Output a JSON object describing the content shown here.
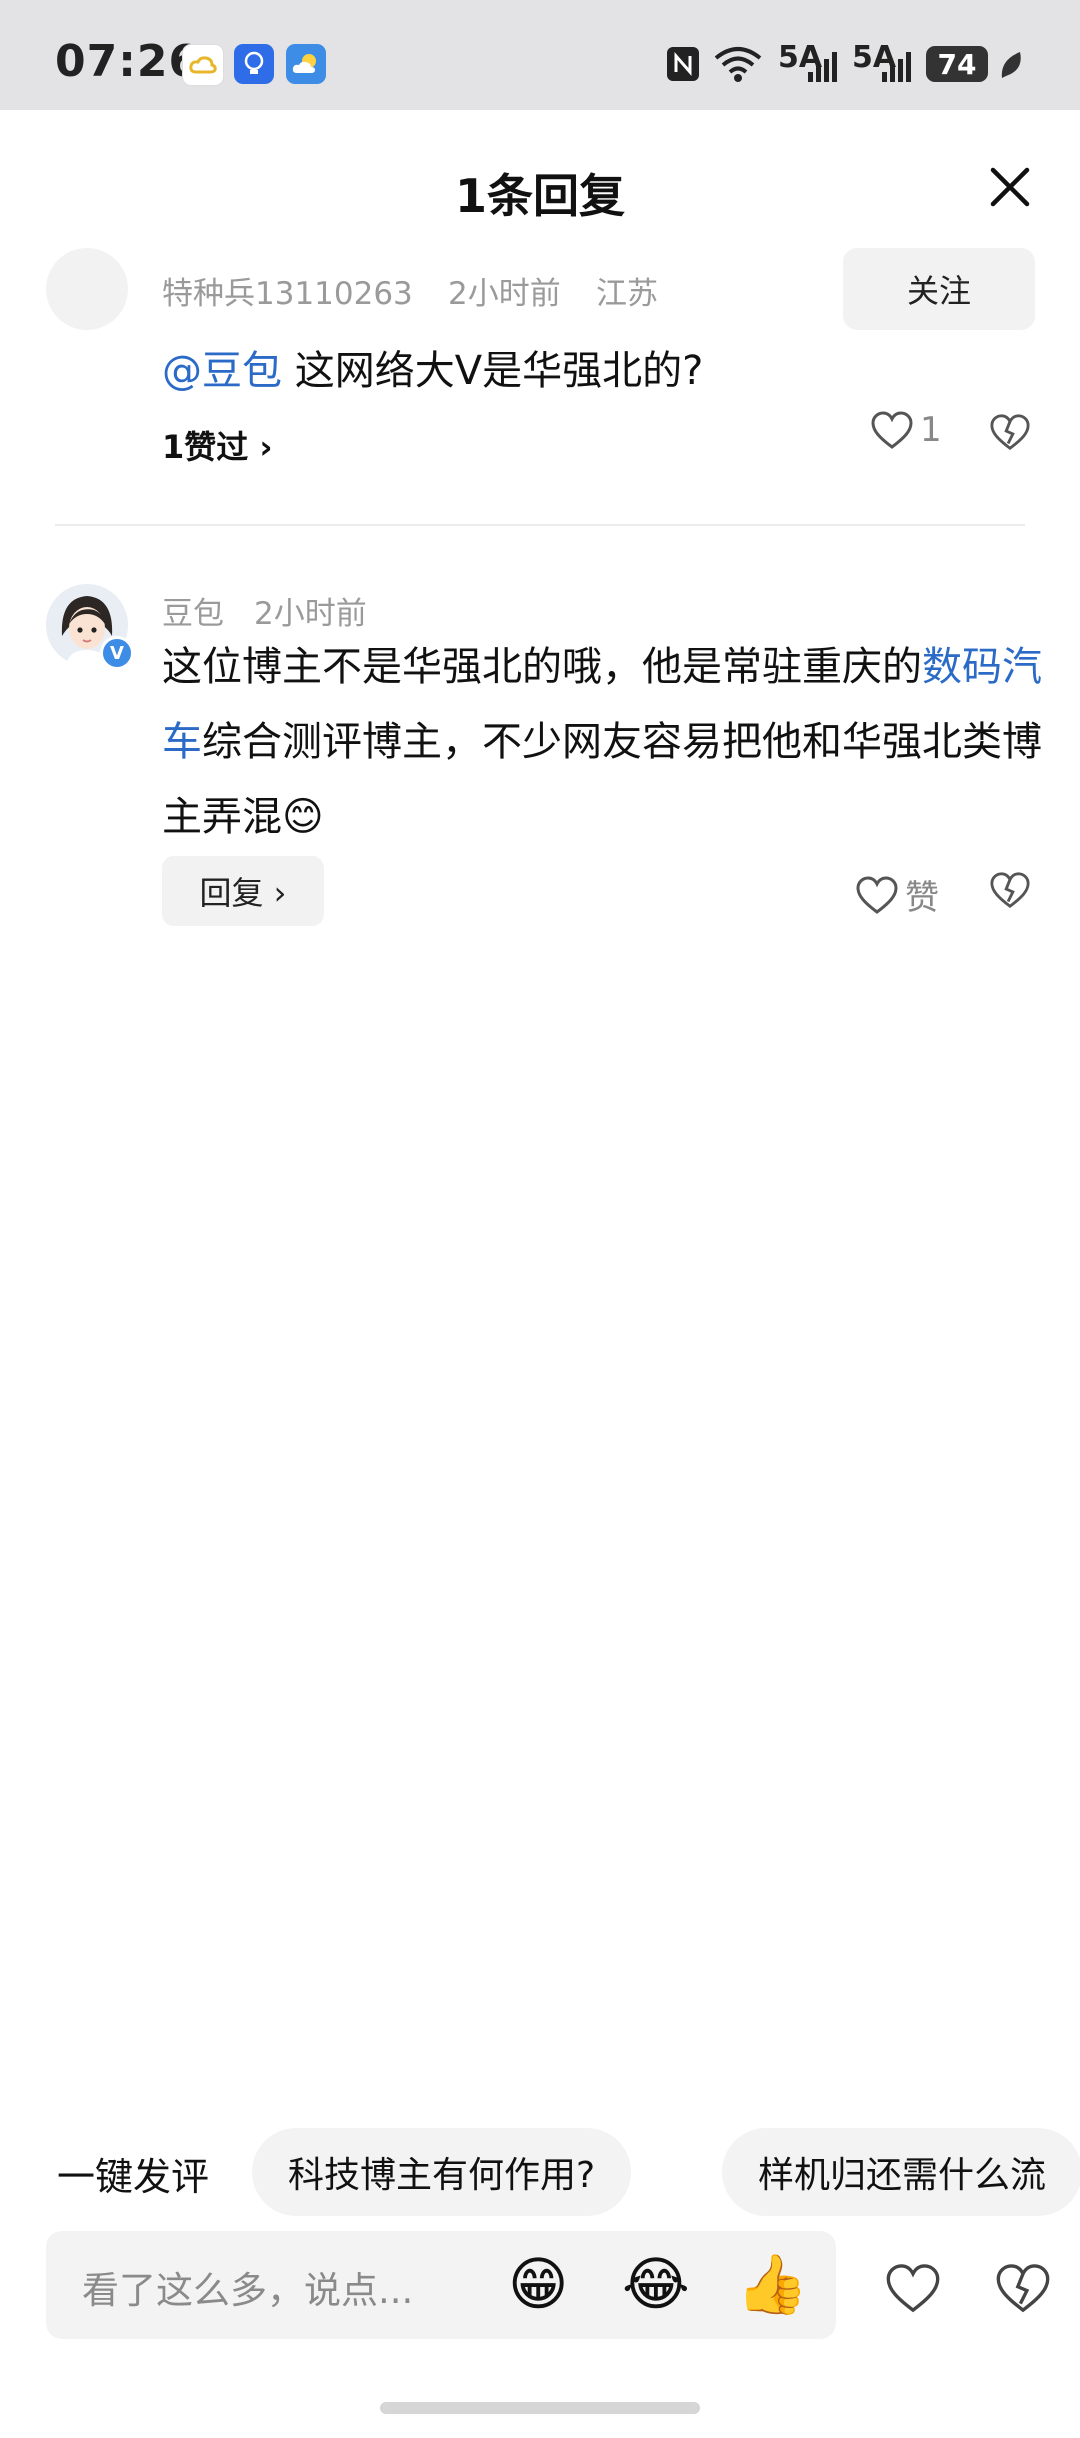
{
  "status_bar": {
    "time": "07:26",
    "network1": "5A",
    "network2": "5A",
    "battery": "74"
  },
  "header": {
    "title": "1条回复"
  },
  "comment1": {
    "username": "特种兵13110263",
    "time": "2小时前",
    "location": "江苏",
    "follow_label": "关注",
    "mention": "@豆包",
    "text": " 这网络大V是华强北的?",
    "likes_summary": "1赞过 ›",
    "like_count": "1"
  },
  "comment2": {
    "username": "豆包",
    "time": "2小时前",
    "badge": "V",
    "text_before": "这位博主不是华强北的哦，他是常驻重庆的",
    "link_text": "数码汽车",
    "text_after": "综合测评博主，不少网友容易把他和华强北类博主弄混😊",
    "reply_label": "回复 ›",
    "like_label": "赞"
  },
  "suggestions": {
    "label": "一键发评",
    "chips": [
      "科技博主有何作用?",
      "样机归还需什么流"
    ]
  },
  "input": {
    "placeholder": "看了这么多，说点...",
    "emoji1": "😁",
    "emoji2": "😂",
    "emoji3": "👍"
  },
  "colors": {
    "accent": "#2b6bc7",
    "status_bar_bg": "#e3e3e5"
  }
}
